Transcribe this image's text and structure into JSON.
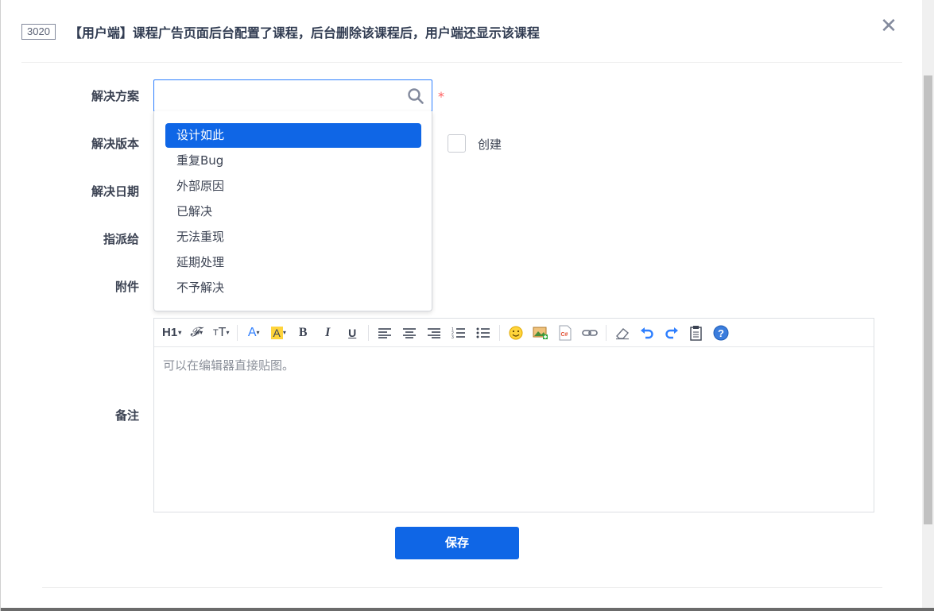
{
  "header": {
    "id_badge": "3020",
    "title": "【用户端】课程广告页面后台配置了课程，后台删除该课程后，用户端还显示该课程",
    "close_icon": "close-icon"
  },
  "form": {
    "solution_label": "解决方案",
    "solution_required_mark": "*",
    "solution_value": "",
    "version_label": "解决版本",
    "date_label": "解决日期",
    "assign_label": "指派给",
    "attachment_label": "附件",
    "remark_label": "备注",
    "create_checkbox_label": "创建",
    "create_checked": false
  },
  "dropdown": {
    "options": [
      "设计如此",
      "重复Bug",
      "外部原因",
      "已解决",
      "无法重现",
      "延期处理",
      "不予解决"
    ],
    "highlighted": "设计如此"
  },
  "editor": {
    "placeholder": "可以在编辑器直接贴图。",
    "toolbar": {
      "heading": "H1",
      "icons": [
        "heading-icon",
        "font-family-icon",
        "font-size-icon",
        "font-color-icon",
        "highlight-color-icon",
        "bold-icon",
        "italic-icon",
        "underline-icon",
        "align-left-icon",
        "align-center-icon",
        "align-right-icon",
        "ordered-list-icon",
        "unordered-list-icon",
        "emoji-icon",
        "image-icon",
        "code-icon",
        "link-icon",
        "eraser-icon",
        "undo-icon",
        "redo-icon",
        "paste-icon",
        "help-icon"
      ]
    }
  },
  "actions": {
    "save_label": "保存"
  },
  "colors": {
    "primary": "#0f66e6",
    "required": "#ff5d5d",
    "text": "#3c4353"
  }
}
